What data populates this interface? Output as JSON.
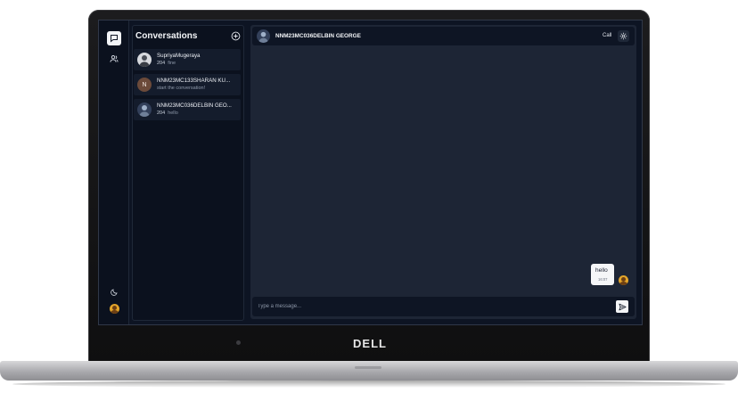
{
  "device": {
    "brand": "DELL"
  },
  "sidebar": {
    "icons": [
      "chat-bubble-icon",
      "users-icon",
      "moon-icon",
      "user-avatar-icon"
    ]
  },
  "conversations": {
    "title": "Conversations",
    "items": [
      {
        "name": "SupriyaMugeraya",
        "count": "204",
        "preview": "fine",
        "avatar": "photo"
      },
      {
        "name": "NNM23MC133SHARAN KU...",
        "count": "",
        "preview": "start the conversation!",
        "avatar": "N"
      },
      {
        "name": "NNM23MC036DELBIN GEO...",
        "count": "204",
        "preview": "hello",
        "avatar": "photo"
      }
    ]
  },
  "chat": {
    "title": "NNM23MC036DELBIN GEORGE",
    "call_label": "Call",
    "messages": [
      {
        "text": "hello",
        "time": "16:07"
      }
    ],
    "input_placeholder": "Type a message..."
  },
  "colors": {
    "app_bg": "#0d1423",
    "panel_bg": "#0b111e",
    "chat_bg": "#1d2535",
    "accent_light": "#f2f4f7"
  }
}
